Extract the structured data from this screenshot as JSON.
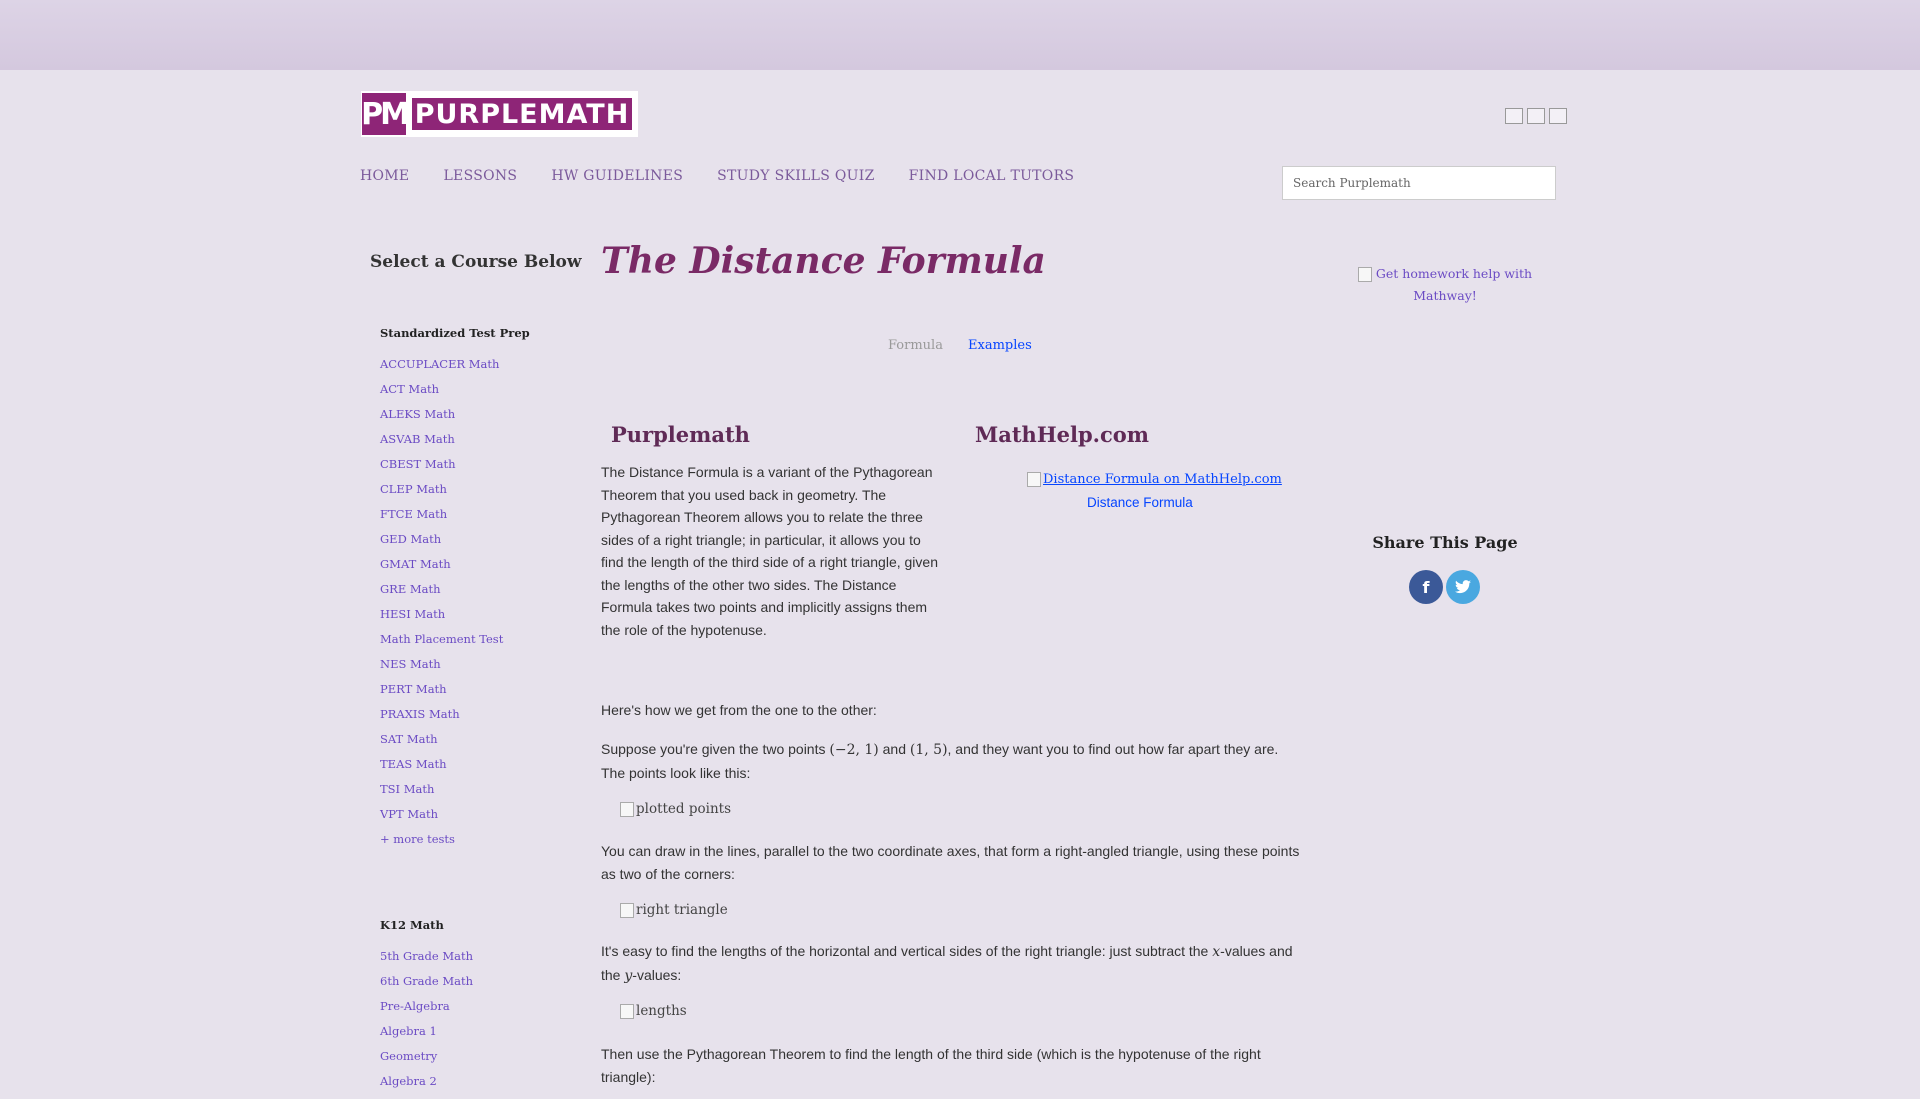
{
  "header": {
    "logo_mark": "PM",
    "logo_word": "PURPLEMATH",
    "search_placeholder": "Search Purplemath"
  },
  "nav": [
    "HOME",
    "LESSONS",
    "HW GUIDELINES",
    "STUDY SKILLS QUIZ",
    "FIND LOCAL TUTORS"
  ],
  "sidebar": {
    "title": "Select a Course Below",
    "groups": [
      {
        "title": "Standardized Test Prep",
        "items": [
          "ACCUPLACER Math",
          "ACT Math",
          "ALEKS Math",
          "ASVAB Math",
          "CBEST Math",
          "CLEP Math",
          "FTCE Math",
          "GED Math",
          "GMAT Math",
          "GRE Math",
          "HESI Math",
          "Math Placement Test",
          "NES Math",
          "PERT Math",
          "PRAXIS Math",
          "SAT Math",
          "TEAS Math",
          "TSI Math",
          "VPT Math",
          "+ more tests"
        ]
      },
      {
        "title": "K12 Math",
        "items": [
          "5th Grade Math",
          "6th Grade Math",
          "Pre-Algebra",
          "Algebra 1",
          "Geometry",
          "Algebra 2"
        ]
      }
    ]
  },
  "main": {
    "title": "The Distance Formula",
    "tabs": {
      "inactive": "Formula",
      "active": "Examples"
    },
    "col_left_heading": "Purplemath",
    "col_right_heading": "MathHelp.com",
    "intro": "The Distance Formula is a variant of the Pythagorean Theorem that you used back in geometry. The Pythagorean Theorem allows you to relate the three sides of a right triangle; in particular, it allows you to find the length of the third side of a right triangle, given the lengths of the other two sides. The Distance Formula takes two points and implicitly assigns them the role of the hypotenuse.",
    "mathhelp_img_alt": "Distance Formula on MathHelp.com",
    "mathhelp_link": "Distance Formula",
    "p_transition": "Here's how we get from the one to the other:",
    "p_suppose_1": "Suppose you're given the two points ",
    "point_a": "(−2, 1)",
    "and_word": " and ",
    "point_b": "(1, 5)",
    "p_suppose_2": ", and they want you to find out how far apart they are. The points look like this:",
    "img_plotted_alt": "plotted points",
    "p_draw": "You can draw in the lines, parallel to the two coordinate axes, that form a right-angled triangle, using these points as two of the corners:",
    "img_triangle_alt": "right triangle",
    "p_lengths_1": "It's easy to find the lengths of the horizontal and vertical sides of the right triangle: just subtract the ",
    "var_x": "x",
    "p_lengths_2": "-values and the ",
    "var_y": "y",
    "p_lengths_3": "-values:",
    "img_lengths_alt": "lengths",
    "p_then": "Then use the Pythagorean Theorem to find the length of the third side (which is the hypotenuse of the right triangle):"
  },
  "right": {
    "ad_text": "Get homework help with Mathway!",
    "share_title": "Share This Page",
    "share_icons": [
      "facebook-icon",
      "twitter-icon"
    ]
  }
}
